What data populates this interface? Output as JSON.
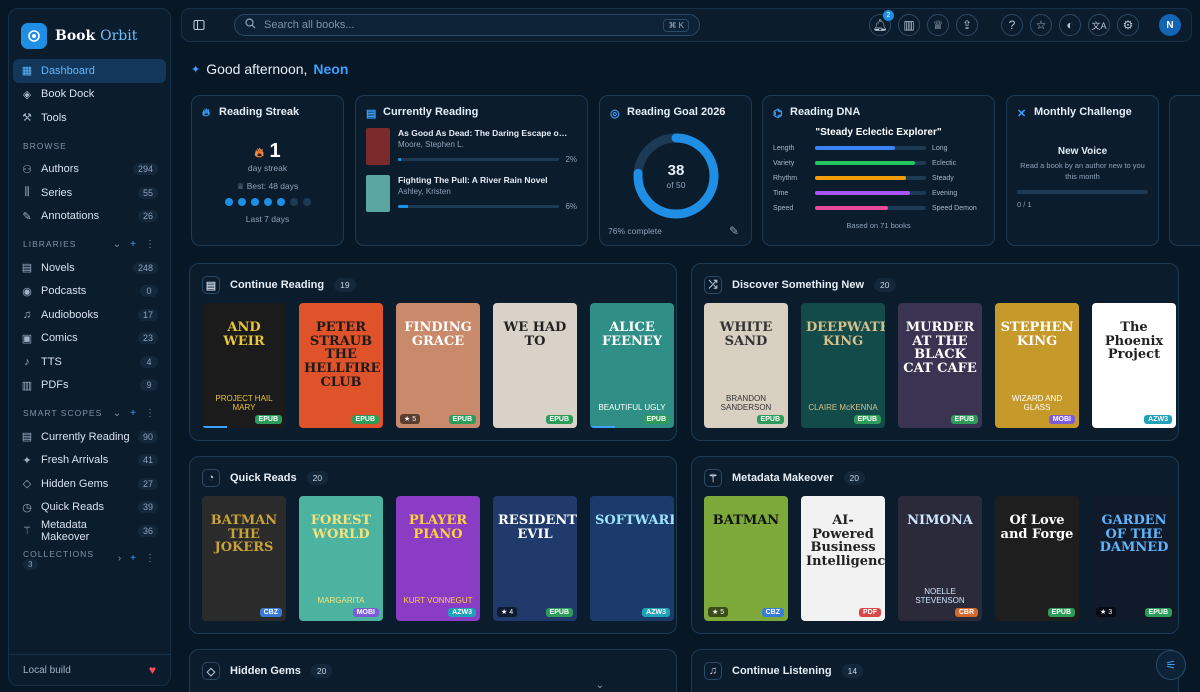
{
  "sidebar": {
    "brand_main": "Book",
    "brand_accent": "Orbit",
    "main": [
      {
        "label": "Dashboard"
      },
      {
        "label": "Book Dock"
      },
      {
        "label": "Tools"
      }
    ],
    "browse_title": "BROWSE",
    "browse": [
      {
        "label": "Authors",
        "count": "294"
      },
      {
        "label": "Series",
        "count": "55"
      },
      {
        "label": "Annotations",
        "count": "26"
      }
    ],
    "libraries_title": "LIBRARIES",
    "libraries": [
      {
        "label": "Novels",
        "count": "248"
      },
      {
        "label": "Podcasts",
        "count": "0"
      },
      {
        "label": "Audiobooks",
        "count": "17"
      },
      {
        "label": "Comics",
        "count": "23"
      },
      {
        "label": "TTS",
        "count": "4"
      },
      {
        "label": "PDFs",
        "count": "9"
      }
    ],
    "scopes_title": "SMART SCOPES",
    "scopes": [
      {
        "label": "Currently Reading",
        "count": "90"
      },
      {
        "label": "Fresh Arrivals",
        "count": "41"
      },
      {
        "label": "Hidden Gems",
        "count": "27"
      },
      {
        "label": "Quick Reads",
        "count": "39"
      },
      {
        "label": "Metadata Makeover",
        "count": "36"
      }
    ],
    "collections_title": "COLLECTIONS",
    "collections_count": "3",
    "footer": "Local build"
  },
  "topbar": {
    "search_placeholder": "Search all books...",
    "shortcut": "⌘ K",
    "notif_count": "2",
    "avatar": "N"
  },
  "greeting": {
    "text": "Good afternoon,",
    "name": "Neon"
  },
  "streak": {
    "title": "Reading Streak",
    "value": "1",
    "unit": "day streak",
    "best": "Best: 48 days",
    "week": [
      1,
      1,
      1,
      1,
      1,
      0,
      0
    ],
    "caption": "Last 7 days"
  },
  "current": {
    "title": "Currently Reading",
    "items": [
      {
        "title": "As Good As Dead: The Daring Escape of ...",
        "author": "Moore, Stephen L.",
        "pct": "2%",
        "progress": 0.02,
        "color": "#7a2a2a"
      },
      {
        "title": "Fighting The Pull: A River Rain Novel",
        "author": "Ashley, Kristen",
        "pct": "6%",
        "progress": 0.06,
        "color": "#5aa6a0"
      }
    ]
  },
  "goal": {
    "title": "Reading Goal 2026",
    "value": "38",
    "of": "of 50",
    "progress": 0.76,
    "caption": "76% complete"
  },
  "dna": {
    "title": "Reading DNA",
    "quote": "\"Steady Eclectic Explorer\"",
    "rows": [
      {
        "left": "Length",
        "right": "Long",
        "value": 0.72,
        "color": "#3b82f6"
      },
      {
        "left": "Variety",
        "right": "Eclectic",
        "value": 0.9,
        "color": "#22c55e"
      },
      {
        "left": "Rhythm",
        "right": "Steady",
        "value": 0.82,
        "color": "#f59e0b"
      },
      {
        "left": "Time",
        "right": "Evening",
        "value": 0.86,
        "color": "#a855f7"
      },
      {
        "left": "Speed",
        "right": "Speed Demon",
        "value": 0.66,
        "color": "#ec4899"
      }
    ],
    "caption": "Based on 71 books"
  },
  "challenge": {
    "title": "Monthly Challenge",
    "heading": "New Voice",
    "text": "Read a book by an author new to you this month",
    "progress": "0 / 1"
  },
  "sections": [
    {
      "title": "Continue Reading",
      "count": "19",
      "books": [
        {
          "t": "AND WEIR",
          "s": "PROJECT HAIL MARY",
          "bg": "#1b1b1b",
          "fg": "#e8c53a",
          "fmt": "EPUB",
          "progress": 0.3
        },
        {
          "t": "PETER STRAUB THE HELLFIRE CLUB",
          "s": "",
          "bg": "#e0532a",
          "fg": "#1a1a1a",
          "fmt": "EPUB",
          "progress": 0
        },
        {
          "t": "FINDING GRACE",
          "s": "",
          "bg": "#c98a6b",
          "fg": "#fff",
          "fmt": "EPUB",
          "rating": "5",
          "progress": 0
        },
        {
          "t": "WE HAD TO",
          "s": "",
          "bg": "#d9d2c8",
          "fg": "#222",
          "fmt": "EPUB",
          "progress": 0
        },
        {
          "t": "ALICE FEENEY",
          "s": "BEAUTIFUL UGLY",
          "bg": "#2f8f86",
          "fg": "#fff",
          "fmt": "EPUB",
          "progress": 0.3
        }
      ]
    },
    {
      "title": "Discover Something New",
      "count": "20",
      "books": [
        {
          "t": "WHITE SAND",
          "s": "BRANDON SANDERSON",
          "bg": "#d8d0c0",
          "fg": "#333",
          "fmt": "EPUB"
        },
        {
          "t": "DEEPWATER KING",
          "s": "CLAIRE McKENNA",
          "bg": "#134a4a",
          "fg": "#d7c08a",
          "fmt": "EPUB"
        },
        {
          "t": "MURDER AT THE BLACK CAT CAFE",
          "s": "",
          "bg": "#3a3352",
          "fg": "#fff",
          "fmt": "EPUB"
        },
        {
          "t": "STEPHEN KING",
          "s": "WIZARD AND GLASS",
          "bg": "#c69a2a",
          "fg": "#fff",
          "fmt": "MOBI"
        },
        {
          "t": "The Phoenix Project",
          "s": "",
          "bg": "#ffffff",
          "fg": "#222",
          "fmt": "AZW3"
        }
      ]
    },
    {
      "title": "Quick Reads",
      "count": "20",
      "books": [
        {
          "t": "BATMAN THE JOKERS",
          "s": "",
          "bg": "#2b2b2b",
          "fg": "#c9a23a",
          "fmt": "CBZ"
        },
        {
          "t": "FOREST WORLD",
          "s": "MARGARITA",
          "bg": "#4bb3a0",
          "fg": "#f6e27a",
          "fmt": "MOBI"
        },
        {
          "t": "PLAYER PIANO",
          "s": "KURT VONNEGUT",
          "bg": "#8a3cc4",
          "fg": "#ffd23a",
          "fmt": "AZW3"
        },
        {
          "t": "RESIDENT EVIL",
          "s": "",
          "bg": "#1f3a6b",
          "fg": "#fff",
          "fmt": "EPUB",
          "rating": "4"
        },
        {
          "t": "SOFTWARE",
          "s": "",
          "bg": "#1a3b6b",
          "fg": "#9fe3ff",
          "fmt": "AZW3"
        }
      ]
    },
    {
      "title": "Metadata Makeover",
      "count": "20",
      "books": [
        {
          "t": "BATMAN",
          "s": "",
          "bg": "#7da83a",
          "fg": "#111",
          "fmt": "CBZ",
          "rating": "5"
        },
        {
          "t": "AI-Powered Business Intelligence",
          "s": "",
          "bg": "#f2f2f2",
          "fg": "#222",
          "fmt": "PDF"
        },
        {
          "t": "NIMONA",
          "s": "NOELLE STEVENSON",
          "bg": "#2a2a3a",
          "fg": "#cfe7ff",
          "fmt": "CBR"
        },
        {
          "t": "Of Love and Forge",
          "s": "",
          "bg": "#1e1e1e",
          "fg": "#fff",
          "fmt": "EPUB"
        },
        {
          "t": "GARDEN OF THE DAMNED",
          "s": "",
          "bg": "#101a2a",
          "fg": "#5fb6ff",
          "fmt": "EPUB",
          "rating": "3"
        }
      ]
    },
    {
      "title": "Hidden Gems",
      "count": "20",
      "books": []
    },
    {
      "title": "Continue Listening",
      "count": "14",
      "books": []
    }
  ]
}
